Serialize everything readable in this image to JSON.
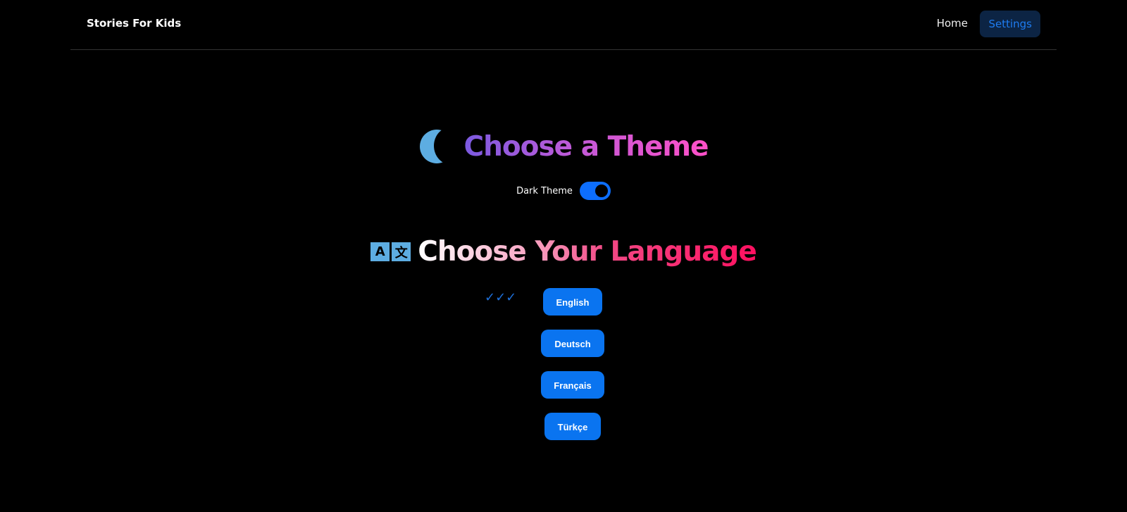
{
  "nav": {
    "brand": "Stories For Kids",
    "home": "Home",
    "settings": "Settings"
  },
  "theme": {
    "title": "Choose a Theme",
    "icon": "moon-icon",
    "toggle_label": "Dark Theme",
    "dark_enabled": true
  },
  "language": {
    "icon": "translate-icon",
    "icon_letters": [
      "A",
      "文"
    ],
    "title_part1": "Choose ",
    "title_part2": "Your Language",
    "selected_marker": "✓✓✓",
    "options": [
      "English",
      "Deutsch",
      "Français",
      "Türkçe"
    ]
  },
  "colors": {
    "accent": "#0a74f0",
    "background": "#000000"
  }
}
